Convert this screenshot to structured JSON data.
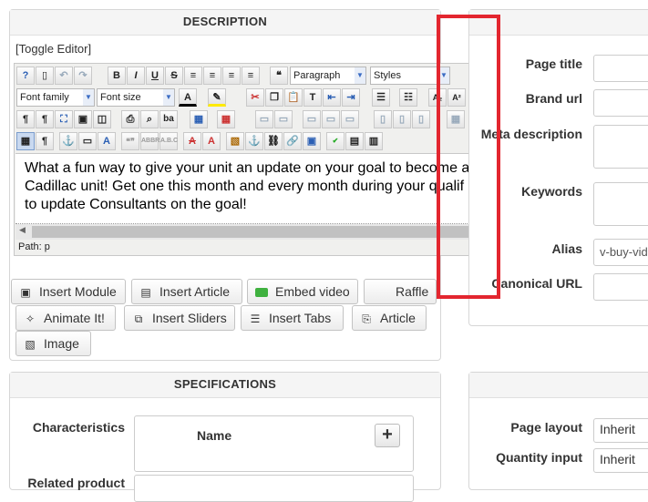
{
  "description": {
    "heading": "DESCRIPTION",
    "toggle_label": "[Toggle Editor]",
    "toolbar": {
      "format_select": "Paragraph",
      "styles_select": "Styles",
      "font_family_select": "Font family",
      "font_size_select": "Font size"
    },
    "content_lines": [
      "What a fun way to give your unit an update on your goal to become a",
      "Cadillac unit!  Get one this month and every month during your qualif",
      "to update Consultants on the goal!"
    ],
    "path_label": "Path:",
    "path_value": "p",
    "buttons": {
      "insert_module": "Insert Module",
      "insert_article": "Insert Article",
      "embed_video": "Embed video",
      "raffle": "Raffle",
      "animate_it": "Animate It!",
      "insert_sliders": "Insert Sliders",
      "insert_tabs": "Insert Tabs",
      "article": "Article",
      "image": "Image"
    }
  },
  "seo": {
    "page_title_label": "Page title",
    "brand_url_label": "Brand url",
    "meta_description_label": "Meta description",
    "keywords_label": "Keywords",
    "alias_label": "Alias",
    "alias_value": "v-buy-vide",
    "canonical_url_label": "Canonical URL"
  },
  "specifications": {
    "heading": "SPECIFICATIONS",
    "characteristics_label": "Characteristics",
    "name_header": "Name",
    "add_icon": "plus-icon",
    "related_label": "Related product"
  },
  "layout": {
    "page_layout_label": "Page layout",
    "page_layout_value": "Inherit",
    "quantity_input_label": "Quantity input",
    "quantity_input_value": "Inherit"
  },
  "colors": {
    "highlight_box": "#e3262f",
    "video_icon": "#3fb13f",
    "panel_border": "#d6d6d6"
  }
}
